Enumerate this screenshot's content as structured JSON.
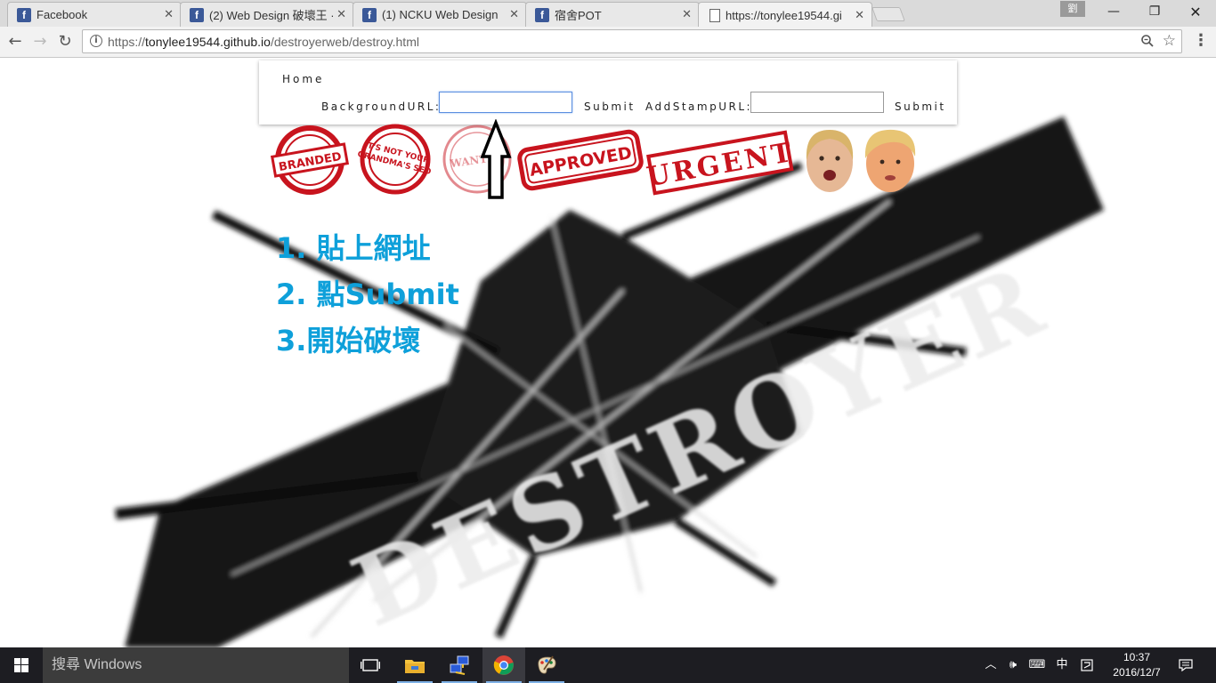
{
  "browser": {
    "tabs": [
      {
        "label": "Facebook",
        "icon": "facebook-icon"
      },
      {
        "label": "(2) Web Design 破壞王 ·",
        "icon": "facebook-icon"
      },
      {
        "label": "(1) NCKU Web Design",
        "icon": "facebook-icon"
      },
      {
        "label": "宿舍POT",
        "icon": "facebook-icon"
      },
      {
        "label": "https://tonylee19544.gi",
        "icon": "page-icon",
        "active": true
      }
    ],
    "profile_label": "劉",
    "url_prefix": "https://",
    "url_host": "tonylee19544.github.io",
    "url_path": "/destroyerweb/destroy.html"
  },
  "page": {
    "nav": {
      "home": "Home",
      "background_label": "BackgroundURL:",
      "background_value": "",
      "submit1": "Submit",
      "stamp_label": "AddStampURL:",
      "stamp_value": "",
      "submit2": "Submit"
    },
    "stamps": [
      {
        "name": "branded-stamp",
        "text": "BRANDED"
      },
      {
        "name": "grandma-seo-stamp",
        "text": "IT'S NOT YOUR GRANDMA'S SEO"
      },
      {
        "name": "wanted-stamp",
        "text": "WANTED"
      },
      {
        "name": "approved-stamp",
        "text": "APPROVED"
      },
      {
        "name": "urgent-stamp",
        "text": "URGENT"
      }
    ],
    "steps": [
      "1. 貼上網址",
      "2. 點Submit",
      "3.開始破壞"
    ],
    "background_text": "DESTROYER",
    "accent_color": "#0ea0da",
    "stamp_color": "#c8141e"
  },
  "taskbar": {
    "search_placeholder": "搜尋 Windows",
    "ime": "中",
    "time": "10:37",
    "date": "2016/12/7"
  }
}
